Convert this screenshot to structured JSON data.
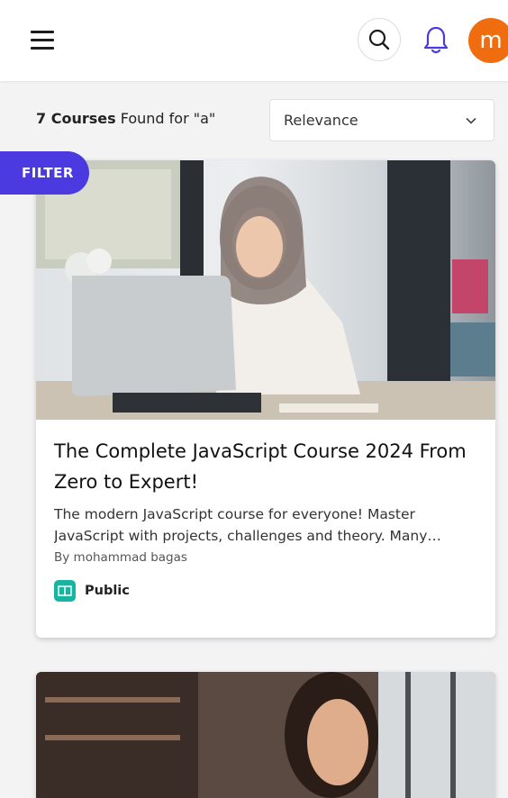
{
  "header": {
    "menu_icon": "hamburger-menu-icon",
    "search_icon": "search-icon",
    "notification_icon": "bell-icon",
    "avatar_initial": "m",
    "avatar_color": "#ef6c0f",
    "accent_color": "#4a3ae0"
  },
  "results": {
    "count_label": "7 Courses",
    "query_text": " Found for \"a\""
  },
  "sort": {
    "selected": "Relevance"
  },
  "filter": {
    "label": "FILTER"
  },
  "courses": [
    {
      "title": "The Complete JavaScript Course 2024 From Zero to Expert!",
      "description": "The modern JavaScript course for everyone! Master JavaScript with projects, challenges and theory. Many courses in one!",
      "author": "By mohammad bagas",
      "visibility": "Public",
      "visibility_icon": "book-icon",
      "visibility_color": "#17b4a1"
    }
  ]
}
